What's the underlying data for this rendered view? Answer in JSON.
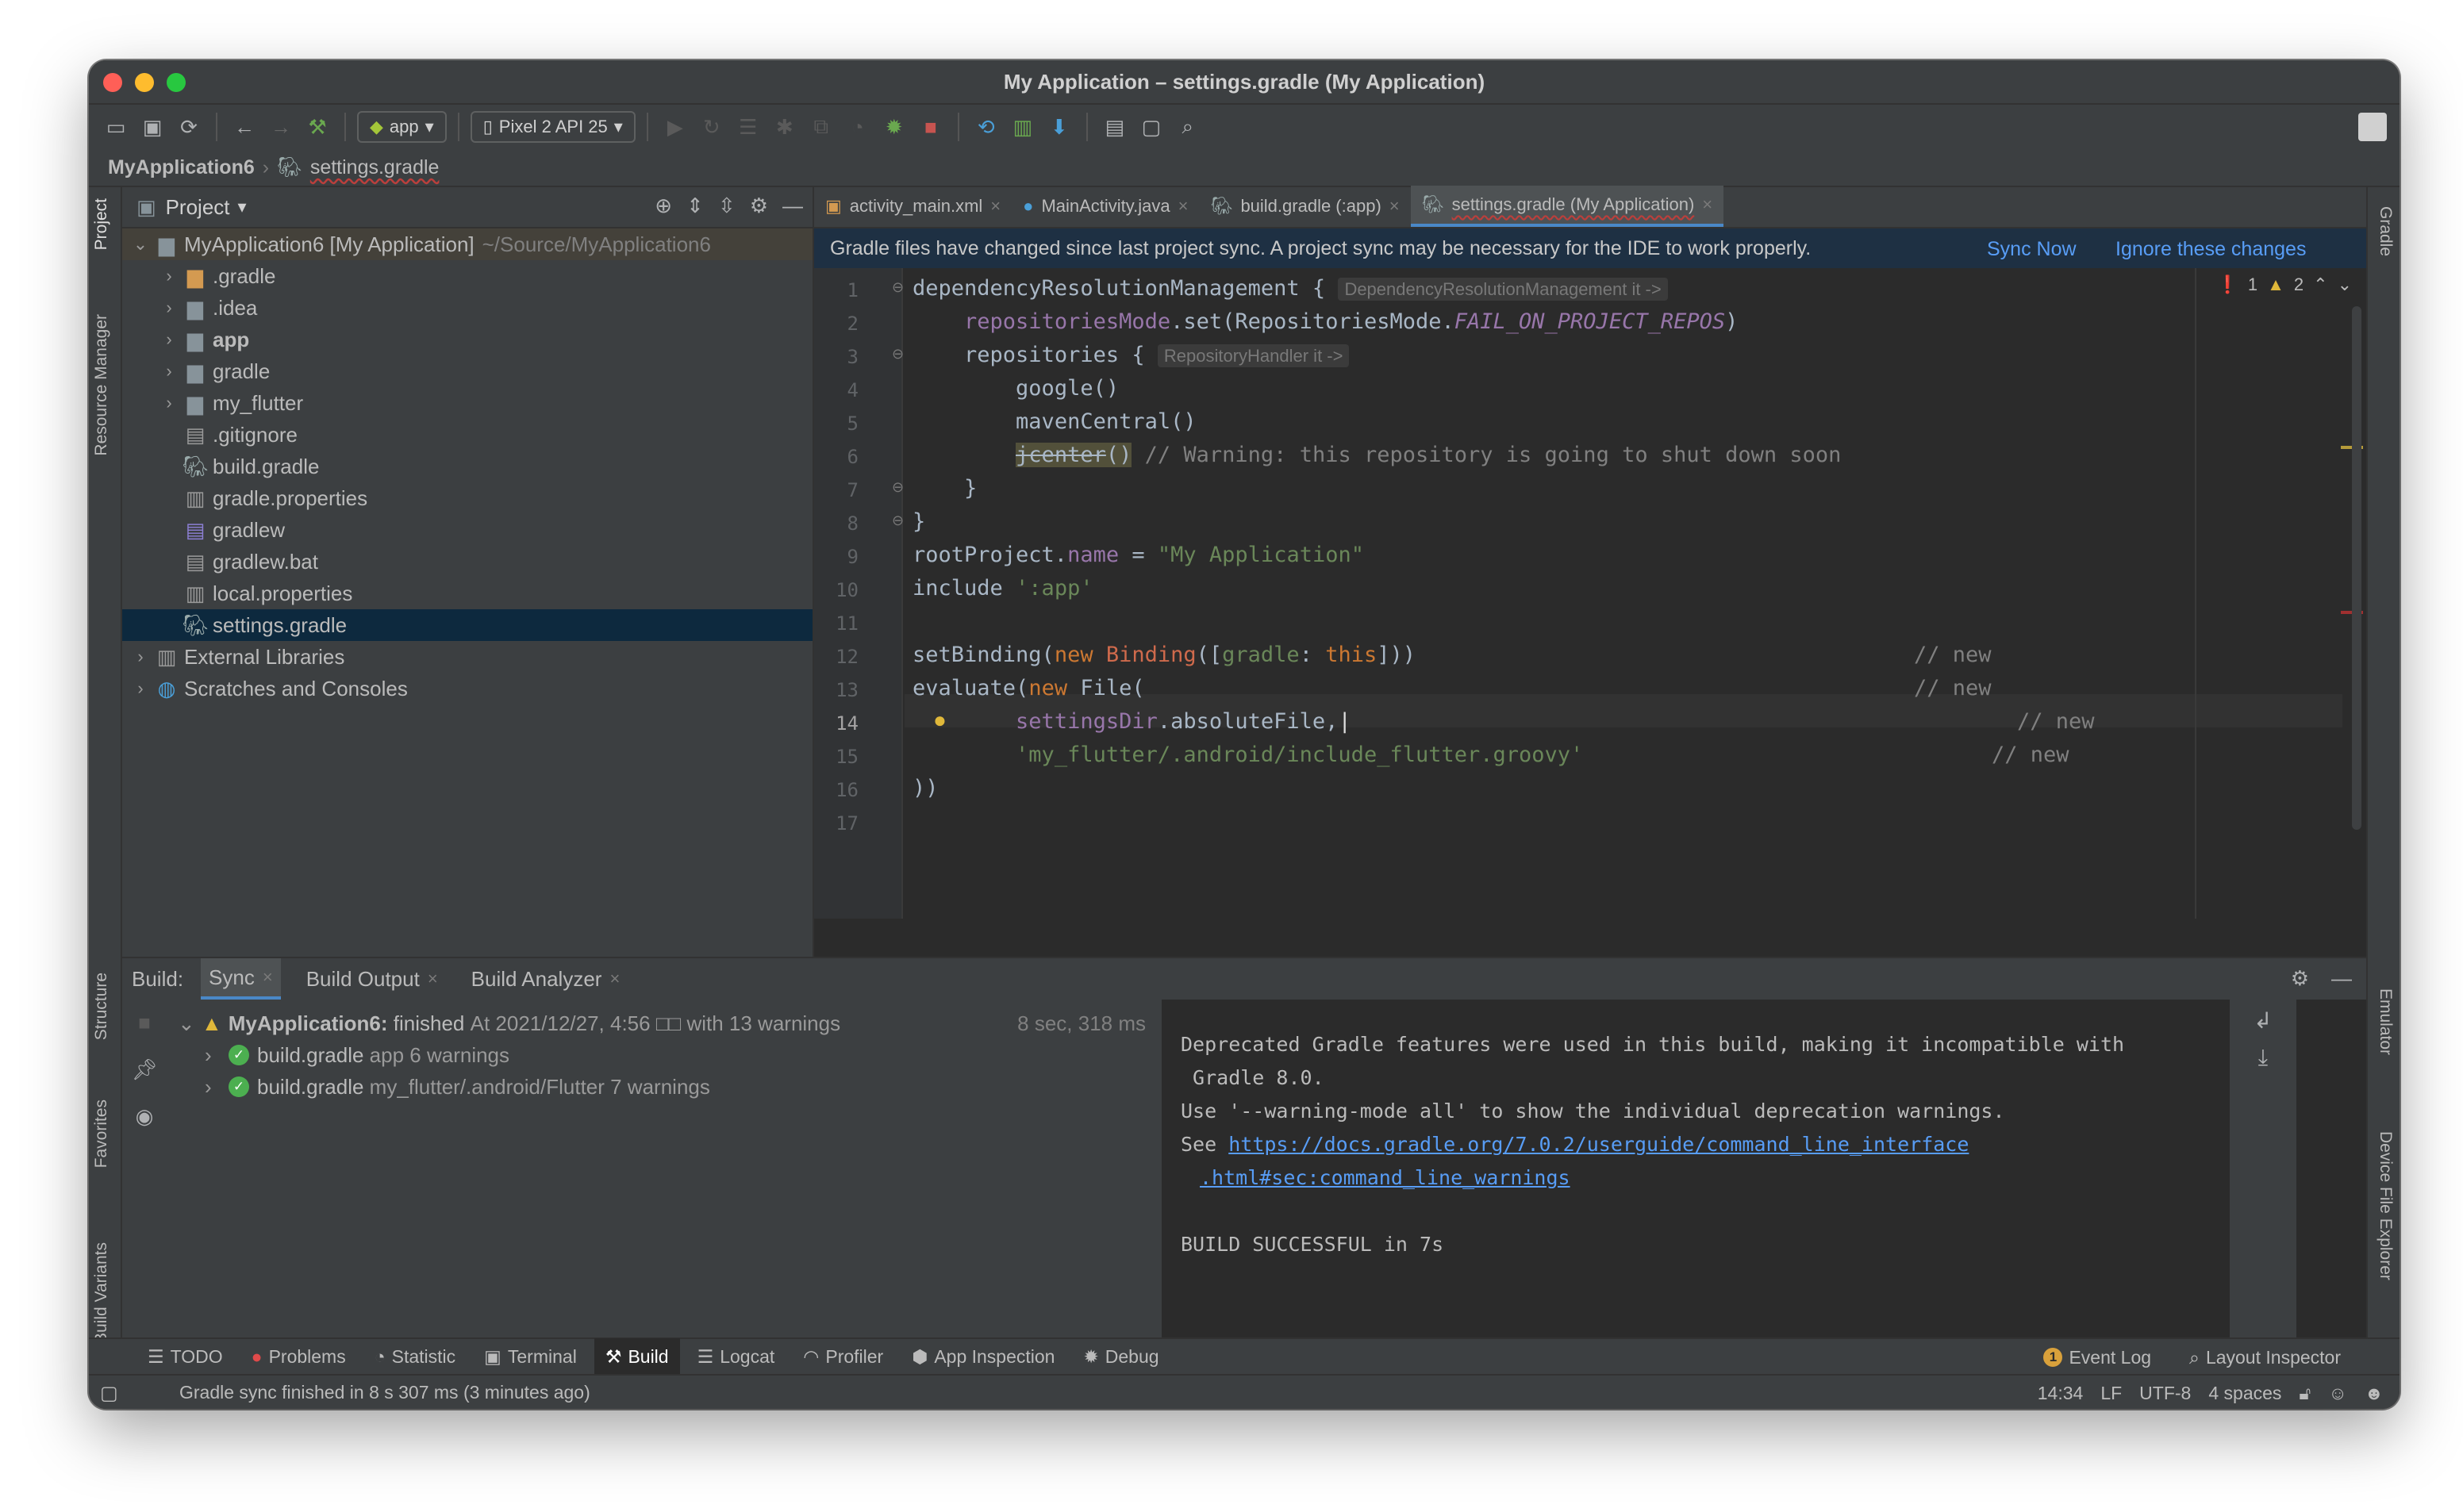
{
  "window": {
    "title": "My Application – settings.gradle (My Application)"
  },
  "toolbar": {
    "run_config": "app",
    "device": "Pixel 2 API 25"
  },
  "breadcrumb": {
    "project": "MyApplication6",
    "file": "settings.gradle"
  },
  "left_strip": {
    "project": "Project",
    "resource_manager": "Resource Manager",
    "structure": "Structure",
    "favorites": "Favorites",
    "build_variants": "Build Variants"
  },
  "right_strip": {
    "gradle": "Gradle",
    "emulator": "Emulator",
    "device_file_explorer": "Device File Explorer"
  },
  "project_panel": {
    "title": "Project",
    "root": {
      "name": "MyApplication6 [My Application]",
      "path": "~/Source/MyApplication6"
    },
    "items": [
      {
        "label": ".gradle"
      },
      {
        "label": ".idea"
      },
      {
        "label": "app"
      },
      {
        "label": "gradle"
      },
      {
        "label": "my_flutter"
      },
      {
        "label": ".gitignore"
      },
      {
        "label": "build.gradle"
      },
      {
        "label": "gradle.properties"
      },
      {
        "label": "gradlew"
      },
      {
        "label": "gradlew.bat"
      },
      {
        "label": "local.properties"
      },
      {
        "label": "settings.gradle"
      }
    ],
    "external_libraries": "External Libraries",
    "scratches": "Scratches and Consoles"
  },
  "editor_tabs": [
    {
      "label": "activity_main.xml"
    },
    {
      "label": "MainActivity.java"
    },
    {
      "label": "build.gradle (:app)"
    },
    {
      "label": "settings.gradle (My Application)"
    }
  ],
  "banner": {
    "message": "Gradle files have changed since last project sync. A project sync may be necessary for the IDE to work properly.",
    "sync_now": "Sync Now",
    "ignore": "Ignore these changes"
  },
  "inspections": {
    "errors": "1",
    "warnings": "2"
  },
  "code": {
    "line_numbers": [
      "1",
      "2",
      "3",
      "4",
      "5",
      "6",
      "7",
      "8",
      "9",
      "10",
      "11",
      "12",
      "13",
      "14",
      "15",
      "16",
      "17"
    ],
    "l1": "dependencyResolutionManagement {",
    "l1_hint": "DependencyResolutionManagement it ->",
    "l2_a": "repositoriesMode",
    "l2_b": ".set(RepositoriesMode.",
    "l2_c": "FAIL_ON_PROJECT_REPOS",
    "l2_d": ")",
    "l3": "repositories {",
    "l3_hint": "RepositoryHandler it ->",
    "l4": "google()",
    "l5": "mavenCentral()",
    "l6_a": "jcenter",
    "l6_b": "()",
    "l6_c": "// Warning: this repository is going to shut down soon",
    "l7": "}",
    "l8": "}",
    "l9_a": "rootProject.",
    "l9_b": "name",
    "l9_c": " = ",
    "l9_d": "\"My Application\"",
    "l10_a": "include ",
    "l10_b": "':app'",
    "l12_a": "setBinding(",
    "l12_b": "new ",
    "l12_c": "Binding",
    "l12_d": "([",
    "l12_e": "gradle",
    "l12_f": ": ",
    "l12_g": "this",
    "l12_h": "]))",
    "l12_cm": "// new",
    "l13_a": "evaluate(",
    "l13_b": "new ",
    "l13_c": "File(",
    "l13_cm": "// new",
    "l14_a": "settingsDir",
    "l14_b": ".absoluteFile,",
    "l14_cm": "// new",
    "l15_a": "'my_flutter/.android/include_flutter.groovy'",
    "l15_cm": "// new",
    "l16": "))"
  },
  "build_panel": {
    "label": "Build:",
    "tabs": [
      {
        "label": "Sync"
      },
      {
        "label": "Build Output"
      },
      {
        "label": "Build Analyzer"
      }
    ],
    "root": {
      "name": "MyApplication6:",
      "status": "finished",
      "detail": "At 2021/12/27, 4:56 □□ with 13 warnings",
      "duration": "8 sec, 318 ms"
    },
    "children": [
      {
        "name": "build.gradle",
        "detail": "app 6 warnings"
      },
      {
        "name": "build.gradle",
        "detail": "my_flutter/.android/Flutter 7 warnings"
      }
    ],
    "output": {
      "line1": "Deprecated Gradle features were used in this build, making it incompatible with",
      "line2": " Gradle 8.0.",
      "line3": "Use '--warning-mode all' to show the individual deprecation warnings.",
      "line4_prefix": "See ",
      "link_part1": "https://docs.gradle.org/7.0.2/userguide/command_line_interface",
      "link_part2": ".html#sec:command_line_warnings",
      "line6": "BUILD SUCCESSFUL in 7s"
    }
  },
  "bottom_tools": [
    {
      "label": "TODO"
    },
    {
      "label": "Problems"
    },
    {
      "label": "Statistic"
    },
    {
      "label": "Terminal"
    },
    {
      "label": "Build"
    },
    {
      "label": "Logcat"
    },
    {
      "label": "Profiler"
    },
    {
      "label": "App Inspection"
    },
    {
      "label": "Debug"
    }
  ],
  "bottom_right": {
    "event_log": "Event Log",
    "event_count": "1",
    "layout_inspector": "Layout Inspector"
  },
  "status": {
    "message": "Gradle sync finished in 8 s 307 ms (3 minutes ago)",
    "position": "14:34",
    "line_sep": "LF",
    "encoding": "UTF-8",
    "indent": "4 spaces"
  }
}
